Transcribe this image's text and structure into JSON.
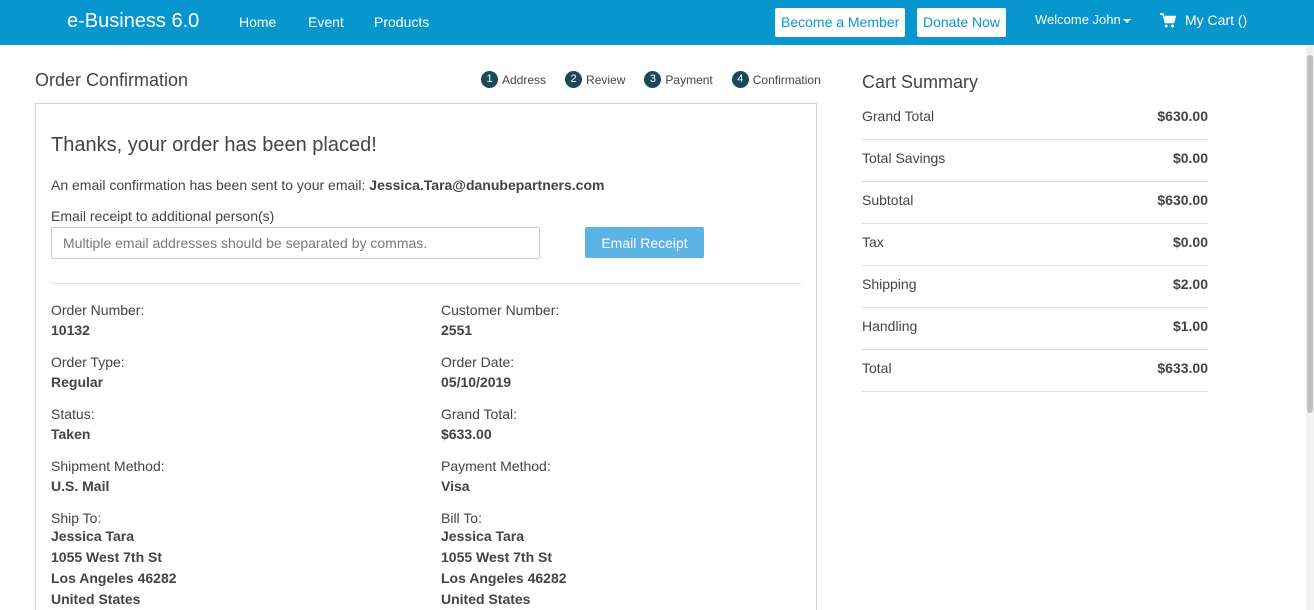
{
  "header": {
    "brand": "e-Business 6.0",
    "nav": [
      "Home",
      "Event",
      "Products"
    ],
    "become_member": "Become a Member",
    "donate": "Donate Now",
    "welcome": "Welcome John",
    "cart": "My Cart ()",
    "bg_color": "#0896cf"
  },
  "main": {
    "title": "Order Confirmation",
    "steps": [
      {
        "num": "1",
        "label": "Address"
      },
      {
        "num": "2",
        "label": "Review"
      },
      {
        "num": "3",
        "label": "Payment"
      },
      {
        "num": "4",
        "label": "Confirmation"
      }
    ],
    "thanks": "Thanks, your order has been placed!",
    "email_note": "An email confirmation has been sent to your email:",
    "email": "Jessica.Tara@danubepartners.com",
    "receipt_label": "Email receipt to additional person(s)",
    "receipt_placeholder": "Multiple email addresses should be separated by commas.",
    "receipt_button": "Email Receipt",
    "fields": {
      "order_number": {
        "label": "Order Number:",
        "value": "10132"
      },
      "customer_number": {
        "label": "Customer Number:",
        "value": "2551"
      },
      "order_type": {
        "label": "Order Type:",
        "value": "Regular"
      },
      "order_date": {
        "label": "Order Date:",
        "value": "05/10/2019"
      },
      "status": {
        "label": "Status:",
        "value": "Taken"
      },
      "grand_total": {
        "label": "Grand Total:",
        "value": "$633.00"
      },
      "shipment_method": {
        "label": "Shipment Method:",
        "value": "U.S. Mail"
      },
      "payment_method": {
        "label": "Payment Method:",
        "value": "Visa"
      }
    },
    "ship_to": {
      "label": "Ship To:",
      "lines": [
        "Jessica Tara",
        "1055 West 7th St",
        "Los Angeles 46282",
        "United States"
      ]
    },
    "bill_to": {
      "label": "Bill To:",
      "lines": [
        "Jessica Tara",
        "1055 West 7th St",
        "Los Angeles 46282",
        "United States"
      ]
    }
  },
  "summary": {
    "title": "Cart Summary",
    "rows": [
      {
        "label": "Grand Total",
        "value": "$630.00"
      },
      {
        "label": "Total Savings",
        "value": "$0.00"
      },
      {
        "label": "Subtotal",
        "value": "$630.00"
      },
      {
        "label": "Tax",
        "value": "$0.00"
      },
      {
        "label": "Shipping",
        "value": "$2.00"
      },
      {
        "label": "Handling",
        "value": "$1.00"
      },
      {
        "label": "Total",
        "value": "$633.00"
      }
    ]
  }
}
